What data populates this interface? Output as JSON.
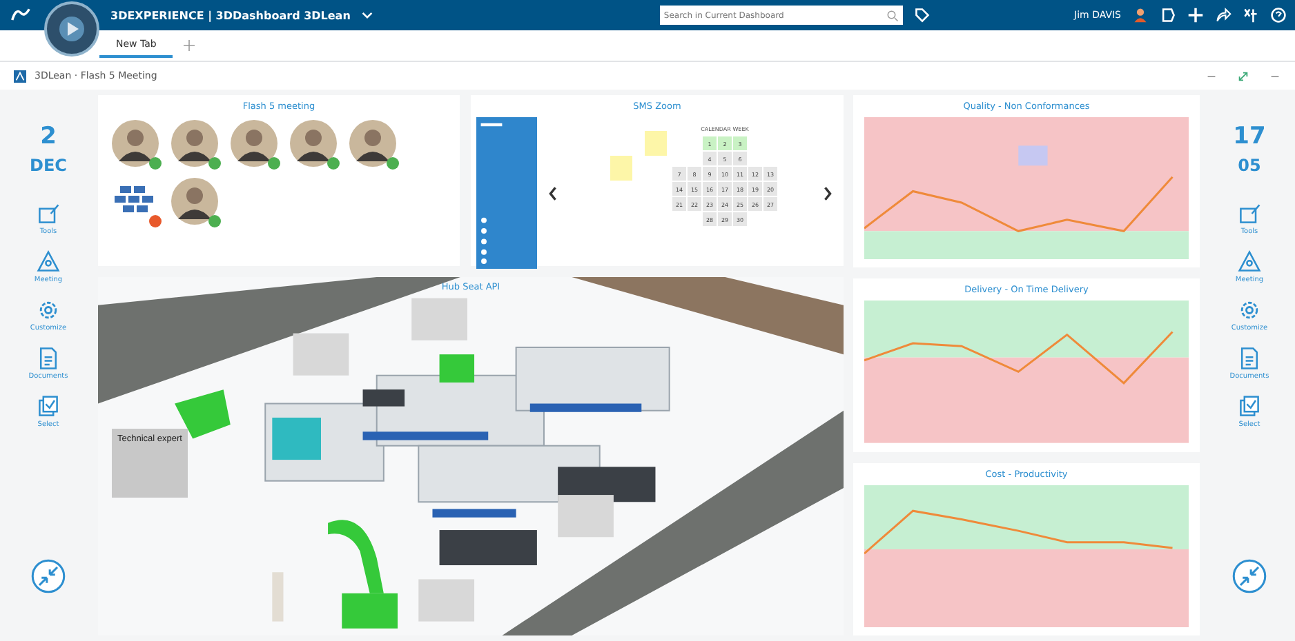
{
  "header": {
    "brand": "3DEXPERIENCE | 3DDashboard 3DLean",
    "search": {
      "placeholder": "Search in Current Dashboard"
    },
    "user": "Jim DAVIS"
  },
  "tabs": [
    {
      "label": "New Tab",
      "selected": true
    }
  ],
  "dashboard_title": "3DLean · Flash 5 Meeting",
  "left_rail": {
    "day": "2",
    "month": "DEC",
    "items": [
      {
        "kind": "tools",
        "label": "Tools"
      },
      {
        "kind": "meeting",
        "label": "Meeting"
      },
      {
        "kind": "customize",
        "label": "Customize"
      },
      {
        "kind": "documents",
        "label": "Documents"
      },
      {
        "kind": "select",
        "label": "Select"
      }
    ]
  },
  "team_card": {
    "title": "Flash 5 meeting",
    "members": [
      {
        "kind": "person",
        "color": "#4caf50"
      },
      {
        "kind": "person",
        "color": "#4caf50"
      },
      {
        "kind": "person",
        "color": "#4caf50"
      },
      {
        "kind": "person",
        "color": "#4caf50"
      },
      {
        "kind": "person",
        "color": "#4caf50"
      },
      {
        "kind": "group",
        "color": "#e8592b"
      },
      {
        "kind": "person",
        "color": "#4caf50"
      }
    ]
  },
  "calendar_card": {
    "title": "SMS Zoom",
    "week_label": "CALENDAR WEEK",
    "rows": [
      {
        "highlighted": true,
        "cells": [
          "1",
          "2",
          "3"
        ]
      },
      {
        "highlighted": false,
        "cells": [
          "4",
          "5",
          "6"
        ]
      },
      {
        "highlighted": false,
        "cells": [
          "7",
          "8",
          "9",
          "10",
          "11",
          "12",
          "13"
        ]
      },
      {
        "highlighted": false,
        "cells": [
          "14",
          "15",
          "16",
          "17",
          "18",
          "19",
          "20"
        ]
      },
      {
        "highlighted": false,
        "cells": [
          "21",
          "22",
          "23",
          "24",
          "25",
          "26",
          "27"
        ]
      },
      {
        "highlighted": false,
        "cells": [
          "28",
          "29",
          "30"
        ]
      }
    ]
  },
  "scene": {
    "title": "Hub Seat API",
    "label": "Technical expert"
  },
  "kpi_charts": [
    {
      "kind": "quality",
      "title": "Quality - Non Conformances"
    },
    {
      "kind": "delivery",
      "title": "Delivery - On Time Delivery"
    },
    {
      "kind": "cost",
      "title": "Cost - Productivity"
    }
  ],
  "right_rail": {
    "day": "17",
    "month": "05",
    "items": [
      {
        "kind": "tools",
        "label": "Tools"
      },
      {
        "kind": "meeting",
        "label": "Meeting"
      },
      {
        "kind": "customize",
        "label": "Customize"
      },
      {
        "kind": "documents",
        "label": "Documents"
      },
      {
        "kind": "select",
        "label": "Select"
      }
    ]
  }
}
